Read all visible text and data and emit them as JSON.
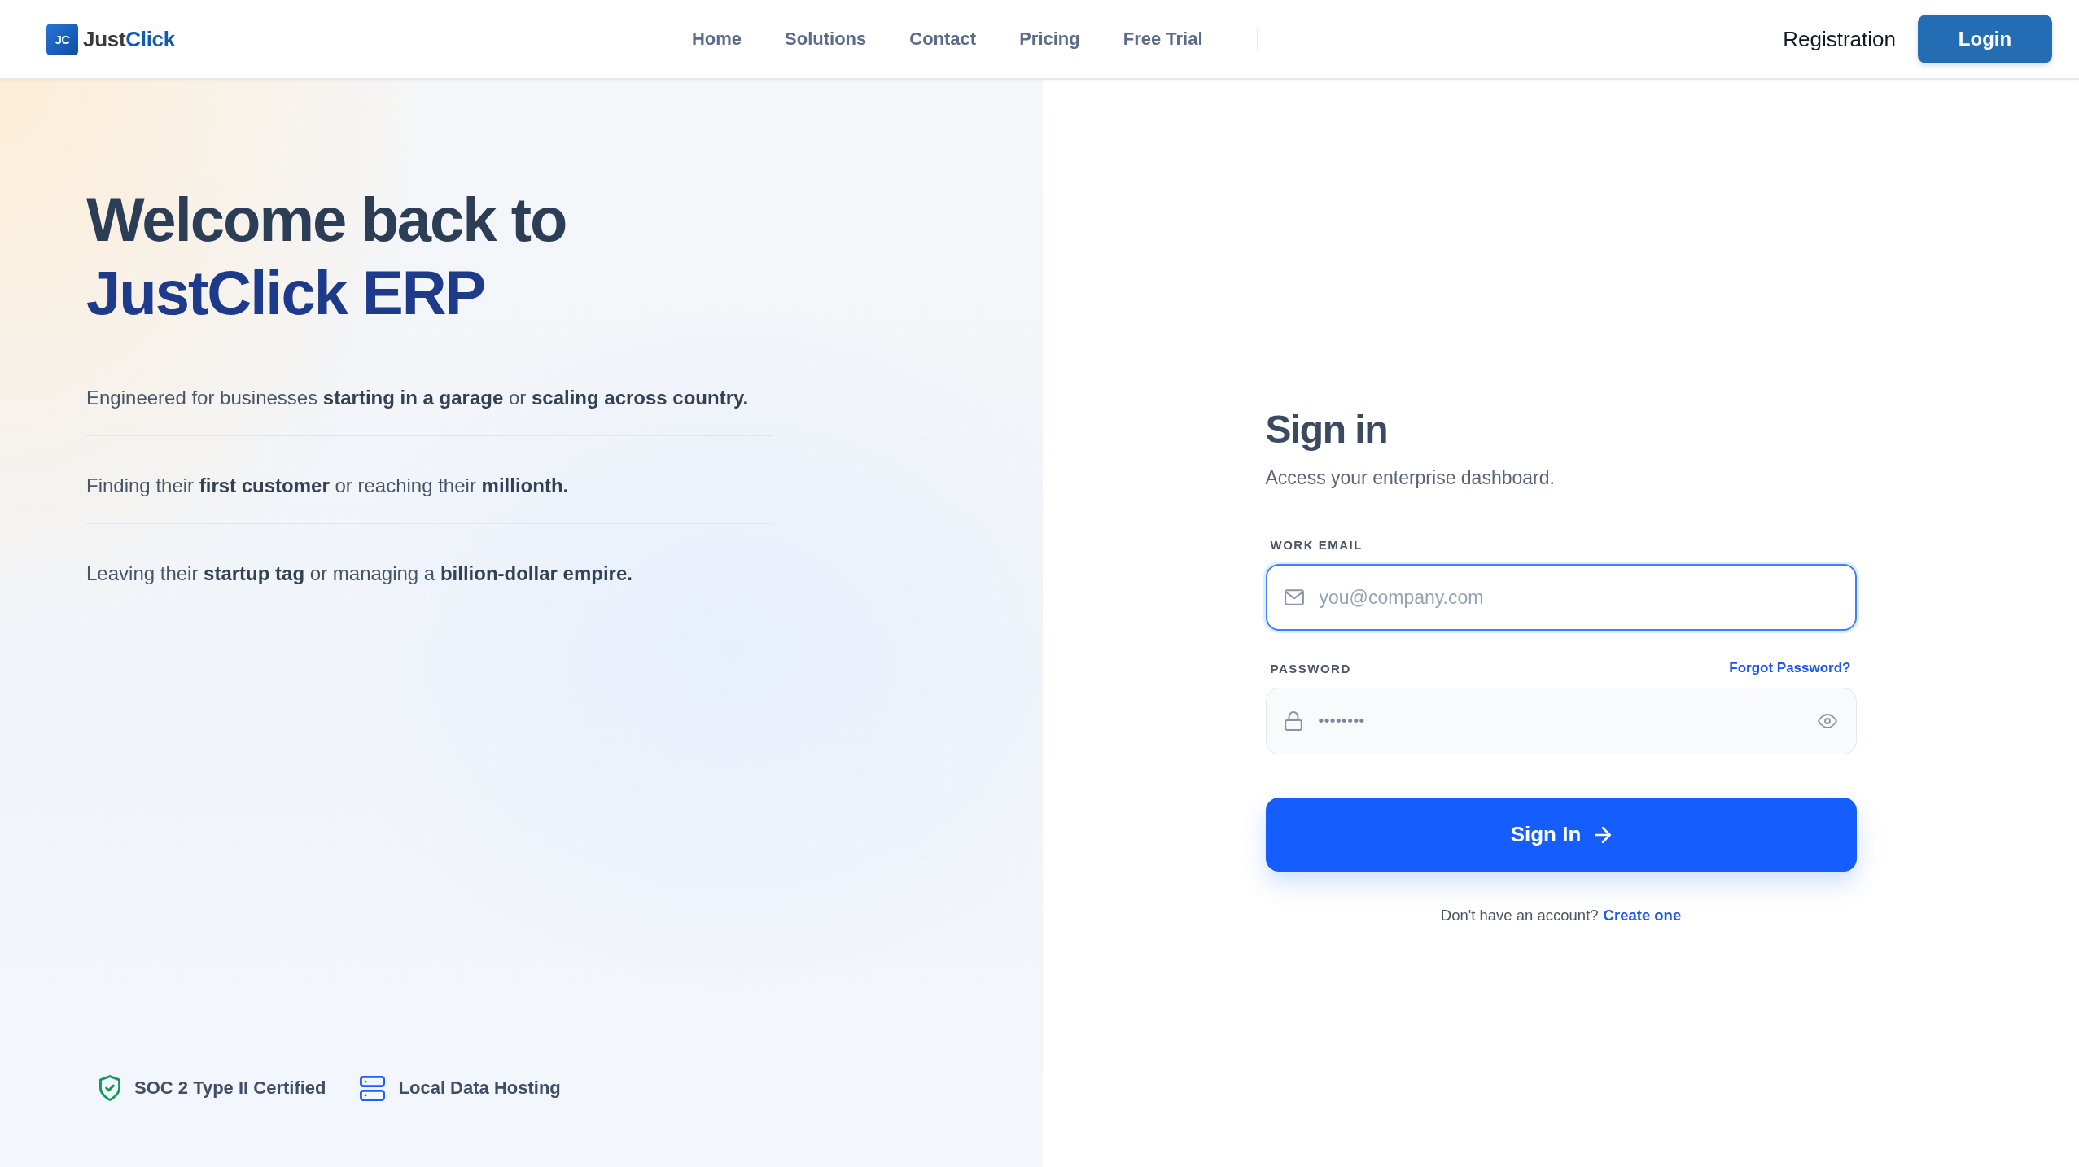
{
  "header": {
    "logo": {
      "mark": "JC",
      "wordmark_dark": "Just",
      "wordmark_accent": "Click"
    },
    "nav": [
      "Home",
      "Solutions",
      "Contact",
      "Pricing",
      "Free Trial"
    ],
    "registration_link": "Registration",
    "login_button": "Login"
  },
  "intro": {
    "title_line_1": "Welcome back to",
    "title_line_2": "JustClick ERP",
    "statements": [
      "Engineered for businesses **starting in a garage** or **scaling across country.**",
      "Finding their **first customer** or reaching their **millionth.**",
      "Leaving their **startup tag** or managing a **billion-dollar empire.**"
    ],
    "badges": [
      {
        "kind": "compliance",
        "label": "SOC 2 Type II Certified"
      },
      {
        "kind": "hosting",
        "label": "Local Data Hosting"
      }
    ]
  },
  "sign_in": {
    "title": "Sign in",
    "subtitle": "Access your enterprise dashboard.",
    "fields": [
      {
        "kind": "email",
        "label": "WORK EMAIL",
        "placeholder": "you@company.com",
        "focused": true
      },
      {
        "kind": "password",
        "label": "PASSWORD",
        "value": "••••••••",
        "focused": false,
        "help_link": "Forgot Password?"
      }
    ],
    "submit_button": "Sign In",
    "signup_prompt": "Don't have an account?",
    "signup_link": "Create one"
  }
}
